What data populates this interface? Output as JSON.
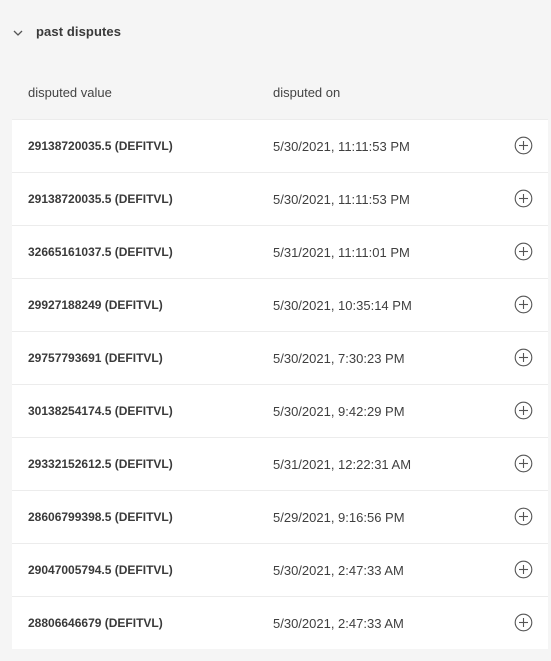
{
  "section": {
    "title": "past disputes"
  },
  "table": {
    "headers": {
      "value": "disputed value",
      "date": "disputed on"
    },
    "rows": [
      {
        "value": "29138720035.5 (DEFITVL)",
        "date": "5/30/2021, 11:11:53 PM"
      },
      {
        "value": "29138720035.5 (DEFITVL)",
        "date": "5/30/2021, 11:11:53 PM"
      },
      {
        "value": "32665161037.5 (DEFITVL)",
        "date": "5/31/2021, 11:11:01 PM"
      },
      {
        "value": "29927188249 (DEFITVL)",
        "date": "5/30/2021, 10:35:14 PM"
      },
      {
        "value": "29757793691 (DEFITVL)",
        "date": "5/30/2021, 7:30:23 PM"
      },
      {
        "value": "30138254174.5 (DEFITVL)",
        "date": "5/30/2021, 9:42:29 PM"
      },
      {
        "value": "29332152612.5 (DEFITVL)",
        "date": "5/31/2021, 12:22:31 AM"
      },
      {
        "value": "28606799398.5 (DEFITVL)",
        "date": "5/29/2021, 9:16:56 PM"
      },
      {
        "value": "29047005794.5 (DEFITVL)",
        "date": "5/30/2021, 2:47:33 AM"
      },
      {
        "value": "28806646679 (DEFITVL)",
        "date": "5/30/2021, 2:47:33 AM"
      }
    ],
    "row_icon": "plus-circle-icon"
  },
  "colors": {
    "page_background": "#f5f5f5",
    "row_background": "#ffffff",
    "text": "#3a3a3a",
    "divider": "#ececec"
  }
}
